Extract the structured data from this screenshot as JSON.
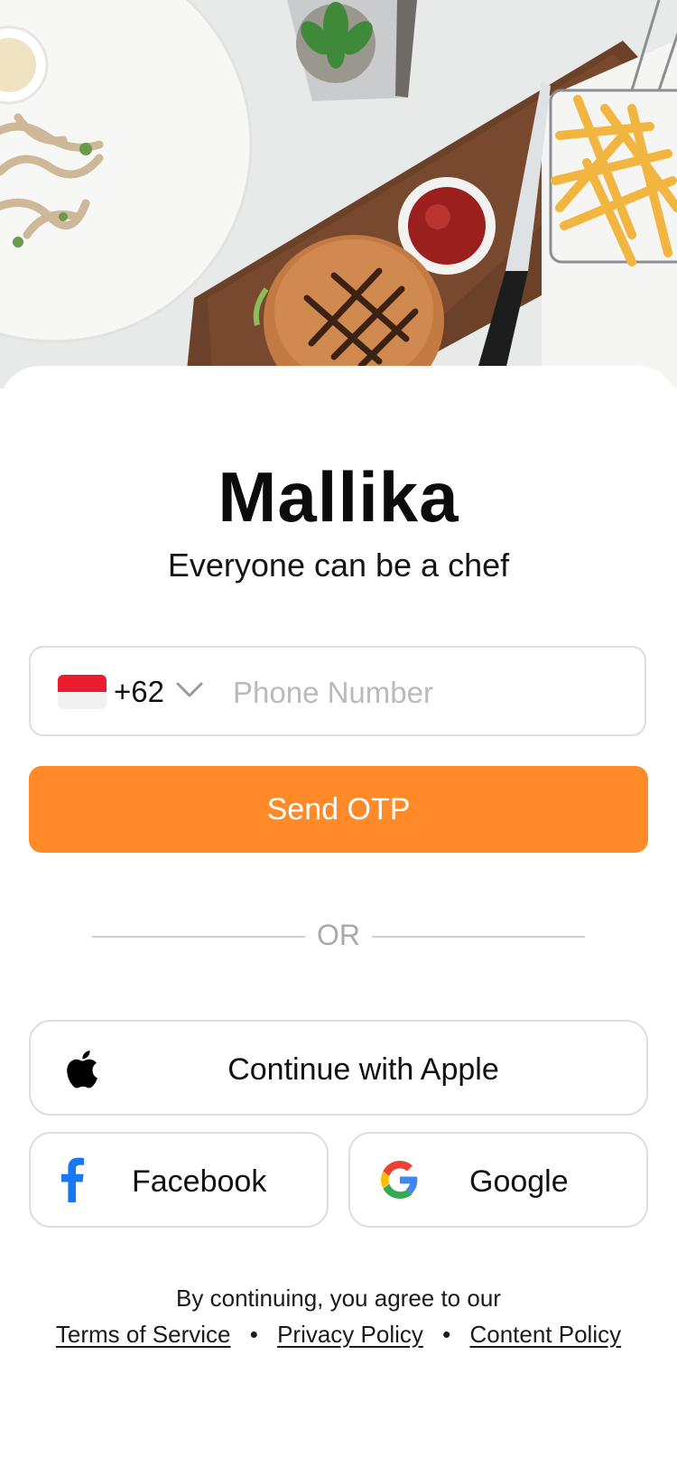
{
  "app": {
    "title": "Mallika",
    "tagline": "Everyone can be a chef"
  },
  "phone": {
    "country_flag": "indonesia-flag",
    "dial_code": "+62",
    "placeholder": "Phone Number",
    "value": ""
  },
  "actions": {
    "send_otp_label": "Send OTP",
    "divider_label": "OR",
    "apple_label": "Continue with Apple",
    "facebook_label": "Facebook",
    "google_label": "Google"
  },
  "legal": {
    "intro": "By continuing, you agree to our",
    "terms": "Terms of Service",
    "privacy": "Privacy Policy",
    "content": "Content Policy"
  },
  "colors": {
    "accent": "#ff8a27",
    "border": "#dedede",
    "facebook_blue": "#1877f2"
  },
  "icons": {
    "apple": "apple-icon",
    "facebook": "facebook-icon",
    "google": "google-icon",
    "chevron": "chevron-down-icon"
  }
}
